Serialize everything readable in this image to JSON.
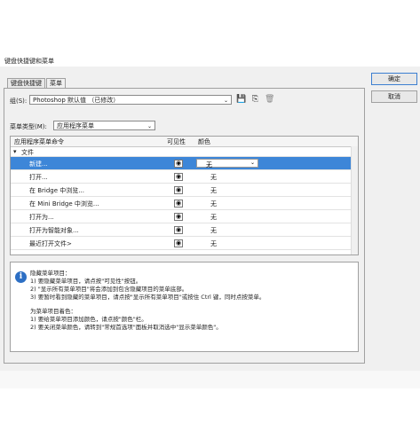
{
  "window": {
    "title": "键盘快捷键和菜单"
  },
  "buttons": {
    "ok": "确定",
    "cancel": "取消"
  },
  "tabs": [
    "键盘快捷键",
    "菜单"
  ],
  "group": {
    "label": "组(S):",
    "value": "Photoshop 默认值 （已修改）"
  },
  "menu_type": {
    "label": "菜单类型(M):",
    "value": "应用程序菜单"
  },
  "table": {
    "headers": {
      "command": "应用程序菜单命令",
      "visibility": "可见性",
      "color": "颜色"
    },
    "section": "文件",
    "rows": [
      {
        "name": "新建...",
        "color": "无",
        "selected": true
      },
      {
        "name": "打开...",
        "color": "无"
      },
      {
        "name": "在 Bridge 中浏览...",
        "color": "无"
      },
      {
        "name": "在 Mini Bridge 中浏览...",
        "color": "无"
      },
      {
        "name": "打开为...",
        "color": "无"
      },
      {
        "name": "打开为智能对象...",
        "color": "无"
      },
      {
        "name": "最近打开文件>",
        "color": "无"
      }
    ]
  },
  "info": {
    "lines_a": [
      "隐藏菜单项目：",
      "1) 要隐藏菜单项目，请点按\"可见性\"按钮。",
      "2) \"显示所有菜单项目\"将会添加到包含隐藏项目的菜单底部。",
      "3) 要暂时看到隐藏的菜单项目，请点按\"显示所有菜单项目\"或按住 Ctrl 键，同时点按菜单。"
    ],
    "lines_b": [
      "为菜单项目着色：",
      "1) 要给菜单项目添加颜色，请点按\"颜色\"栏。",
      "2) 要关闭菜单颜色，请转到\"常规首选项\"面板并取消选中\"显示菜单颜色\"。"
    ]
  },
  "colors": {
    "accent": "#3d86d8",
    "arrow": "#2e9e3a"
  },
  "icons": [
    "save-icon",
    "save-as-icon",
    "delete-icon",
    "info-icon",
    "eye-icon"
  ]
}
